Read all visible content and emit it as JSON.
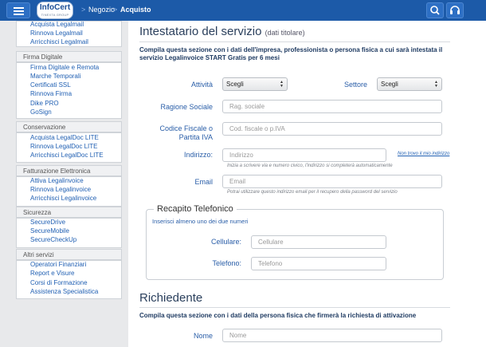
{
  "topbar": {
    "logo": {
      "main": "InfoCert",
      "sub": "TINEXTA GROUP"
    },
    "breadcrumb": [
      "Negozio",
      "Acquisto"
    ],
    "separator": ">",
    "icons": [
      "menu-icon",
      "search-icon",
      "headset-icon"
    ]
  },
  "sidebar": {
    "top_items": [
      "Acquista Legalmail",
      "Rinnova Legalmail",
      "Arricchisci Legalmail"
    ],
    "groups": [
      {
        "title": "Firma Digitale",
        "items": [
          "Firma Digitale e Remota",
          "Marche Temporali",
          "Certificati SSL",
          "Rinnova Firma",
          "Dike PRO",
          "GoSign"
        ]
      },
      {
        "title": "Conservazione",
        "items": [
          "Acquista LegalDoc LITE",
          "Rinnova LegalDoc LITE",
          "Arricchisci LegalDoc LITE"
        ]
      },
      {
        "title": "Fatturazione Elettronica",
        "items": [
          "Attiva Legalinvoice",
          "Rinnova Legalinvoice",
          "Arricchisci Legalinvoice"
        ]
      },
      {
        "title": "Sicurezza",
        "items": [
          "SecureDrive",
          "SecureMobile",
          "SecureCheckUp"
        ]
      },
      {
        "title": "Altri servizi",
        "items": [
          "Operatori Finanziari",
          "Report e Visure",
          "Corsi di Formazione",
          "Assistenza Specialistica"
        ]
      }
    ]
  },
  "main": {
    "intestatario": {
      "title": "Intestatario del servizio",
      "subtitle": "(dati titolare)",
      "intro": "Compila questa sezione con i dati dell'impresa, professionista o persona fisica a cui sarà intestata il servizio Legalinvoice START Gratis per 6 mesi",
      "attivita": {
        "label": "Attività",
        "value": "Scegli"
      },
      "settore": {
        "label": "Settore",
        "value": "Scegli"
      },
      "ragione_sociale": {
        "label": "Ragione Sociale",
        "placeholder": "Rag. sociale"
      },
      "codice_fiscale": {
        "label_line1": "Codice Fiscale o",
        "label_line2": "Partita IVA",
        "placeholder": "Cod. fiscale o p.IVA"
      },
      "indirizzo": {
        "label": "Indirizzo:",
        "placeholder": "Indirizzo",
        "link": "Non trovo il mio indirizzo",
        "hint": "Inizia a scrivere via e numero civico, l'indirizzo si completerà automaticamente"
      },
      "email": {
        "label": "Email",
        "placeholder": "Email",
        "hint": "Potrai utilizzare questo indirizzo email per il recupero della password del servizio"
      }
    },
    "recapito": {
      "legend": "Recapito Telefonico",
      "hint": "Inserisci almeno uno dei due numeri",
      "cellulare": {
        "label": "Cellulare:",
        "placeholder": "Cellulare"
      },
      "telefono": {
        "label": "Telefono:",
        "placeholder": "Telefono"
      }
    },
    "richiedente": {
      "title": "Richiedente",
      "intro": "Compila questa sezione con i dati della persona fisica che firmerà la richiesta di attivazione",
      "nome": {
        "label": "Nome",
        "placeholder": "Nome"
      }
    }
  }
}
